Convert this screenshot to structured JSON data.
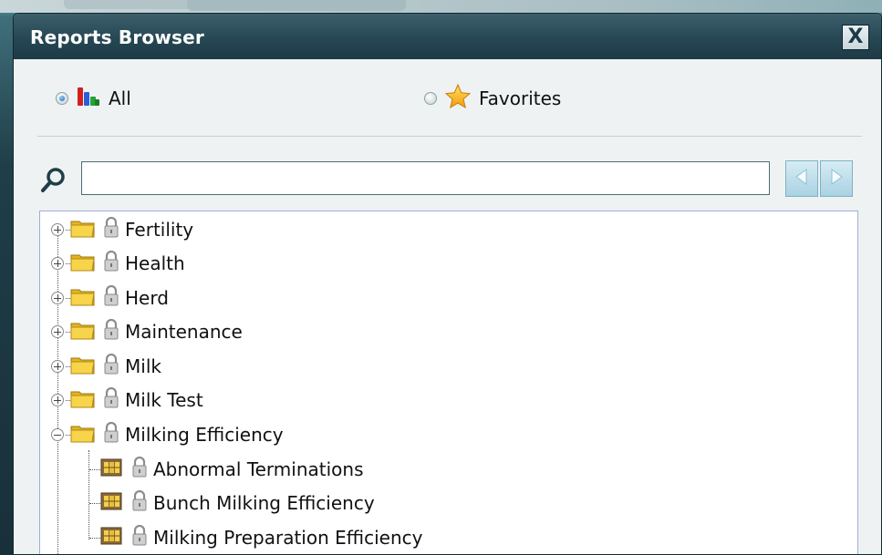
{
  "window": {
    "title": "Reports Browser",
    "close_label": "X"
  },
  "filter": {
    "all_label": "All",
    "all_selected": true,
    "favorites_label": "Favorites",
    "favorites_selected": false
  },
  "search": {
    "value": "",
    "placeholder": ""
  },
  "tree": {
    "folders": [
      {
        "label": "Fertility",
        "expanded": false
      },
      {
        "label": "Health",
        "expanded": false
      },
      {
        "label": "Herd",
        "expanded": false
      },
      {
        "label": "Maintenance",
        "expanded": false
      },
      {
        "label": "Milk",
        "expanded": false
      },
      {
        "label": "Milk Test",
        "expanded": false
      },
      {
        "label": "Milking Efficiency",
        "expanded": true
      }
    ],
    "reports": [
      {
        "label": "Abnormal Terminations"
      },
      {
        "label": "Bunch Milking Efficiency"
      },
      {
        "label": "Milking Preparation Efficiency"
      }
    ]
  },
  "colors": {
    "titlebar": "#264754",
    "dialog_bg": "#eef2f2",
    "folder": "#f3cc3c",
    "nav_button": "#a9d2e2"
  },
  "icons": {
    "all": "bar-chart-icon",
    "favorites": "star-icon",
    "search": "search-icon",
    "folder": "folder-icon",
    "lock": "lock-icon",
    "report": "report-icon"
  }
}
